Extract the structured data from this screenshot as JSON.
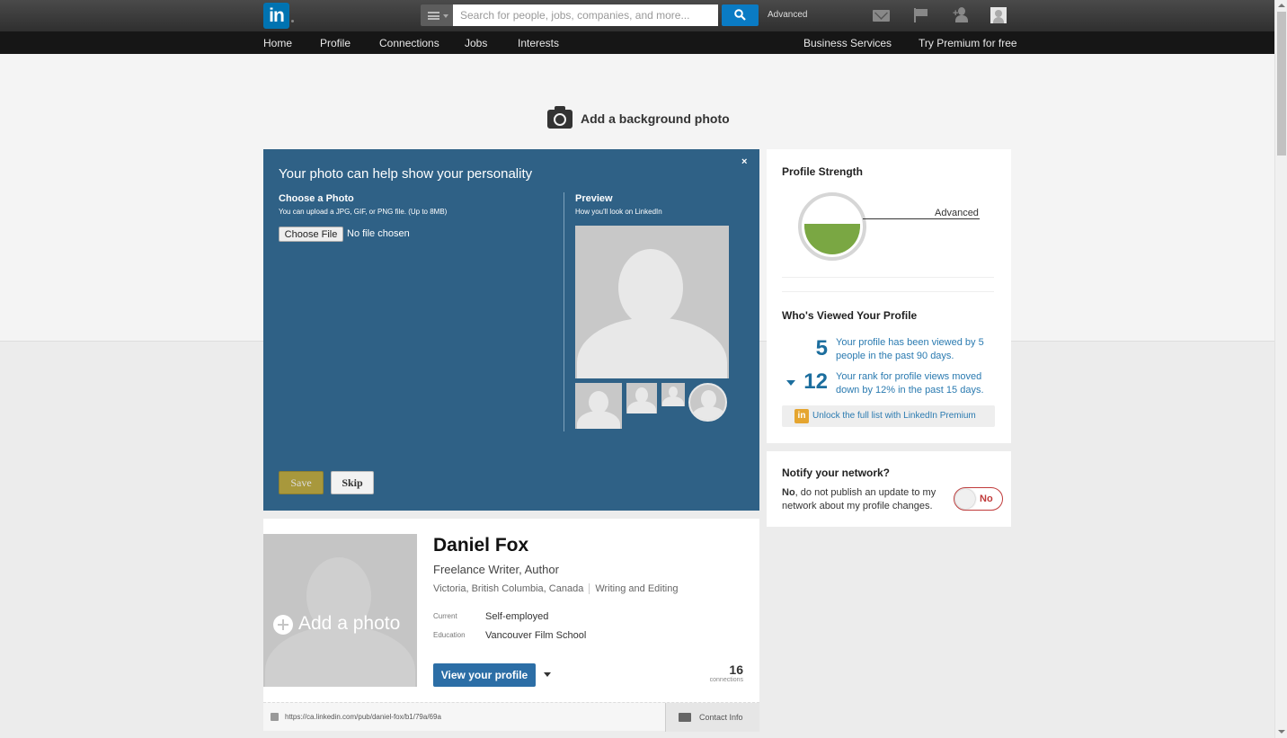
{
  "header": {
    "logo_text": "in",
    "search": {
      "placeholder": "Search for people, jobs, companies, and more...",
      "value": ""
    },
    "advanced_label": "Advanced"
  },
  "nav": {
    "items": [
      "Home",
      "Profile",
      "Connections",
      "Jobs",
      "Interests"
    ],
    "right_items": [
      "Business Services",
      "Try Premium for free"
    ]
  },
  "background": {
    "add_label": "Add a background photo"
  },
  "photo_modal": {
    "title": "Your photo can help show your personality",
    "close": "×",
    "choose_heading": "Choose a Photo",
    "choose_sub": "You can upload a JPG, GIF, or PNG file. (Up to 8MB)",
    "file_button": "Choose File",
    "file_status": "No file chosen",
    "preview_heading": "Preview",
    "preview_sub": "How you'll look on LinkedIn",
    "save_label": "Save",
    "skip_label": "Skip"
  },
  "profile": {
    "add_photo_label": "Add a photo",
    "name": "Daniel Fox",
    "headline": "Freelance Writer, Author",
    "location": "Victoria, British Columbia, Canada",
    "industry": "Writing and Editing",
    "current_label": "Current",
    "current_value": "Self-employed",
    "education_label": "Education",
    "education_value": "Vancouver Film School",
    "view_button": "View your profile",
    "connections_count": "16",
    "connections_label": "connections",
    "url": "https://ca.linkedin.com/pub/daniel-fox/b1/79a/69a",
    "contact_label": "Contact Info"
  },
  "strength": {
    "title": "Profile Strength",
    "level": "Advanced",
    "level_fraction": 0.5
  },
  "viewers": {
    "title": "Who's Viewed Your Profile",
    "views_count": "5",
    "views_text": "Your profile has been viewed by 5 people in the past 90 days.",
    "rank_count": "12",
    "rank_text": "Your rank for profile views moved down by 12% in the past 15 days.",
    "premium_label": "Unlock the full list with LinkedIn Premium"
  },
  "notify": {
    "title": "Notify your network?",
    "text_bold": "No",
    "text_rest": ", do not publish an update to my network about my profile changes.",
    "toggle_label": "No"
  },
  "colors": {
    "brand": "#0073b1",
    "modal": "#2f6186",
    "strength": "#7aa743",
    "toggle_off": "#c03a3a"
  }
}
